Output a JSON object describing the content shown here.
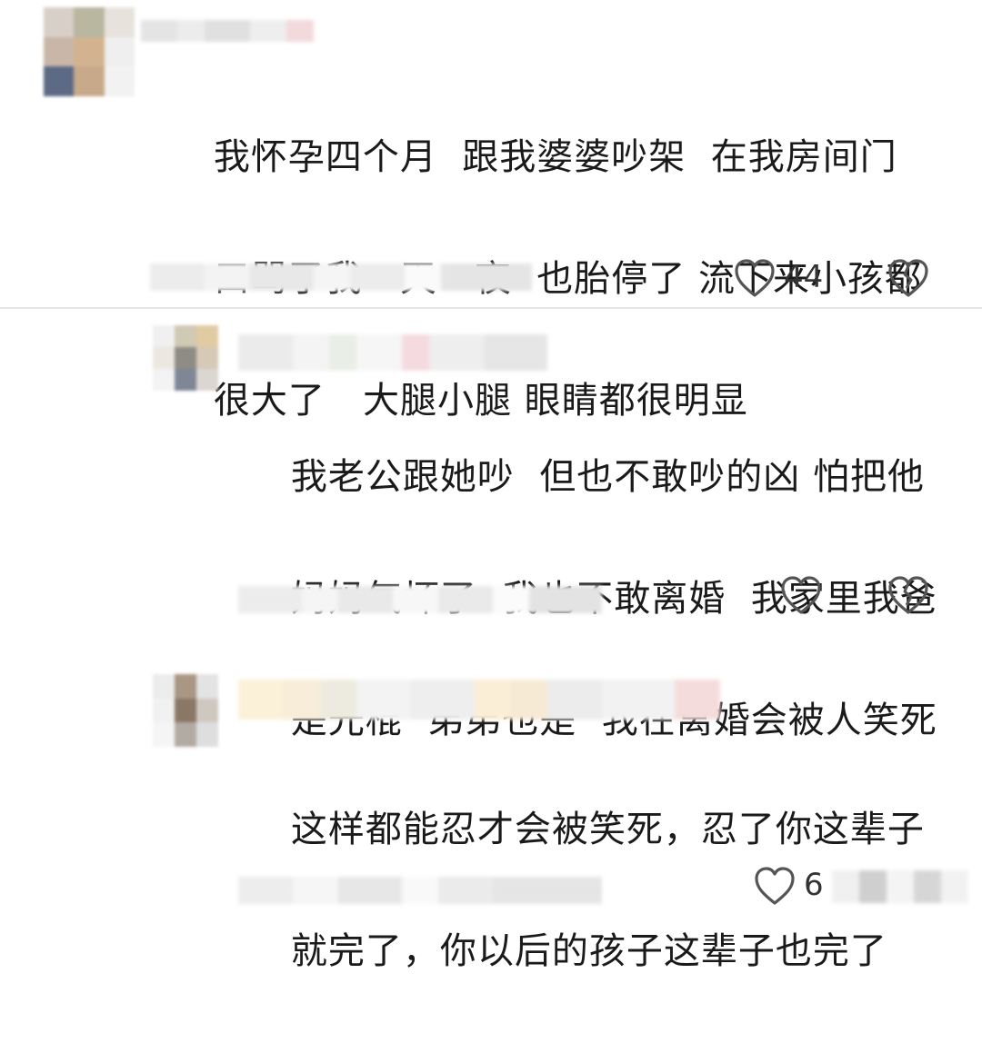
{
  "comments": [
    {
      "author": "",
      "lines": [
        "我怀孕四个月  跟我婆婆吵架  在我房间门",
        "口骂了我一天一夜  也胎停了 流下来小孩都",
        "很大了   大腿小腿 眼睛都很明显"
      ],
      "likes": "44",
      "icons": [
        "heart-outline-icon",
        "broken-heart-icon"
      ]
    },
    {
      "author": "",
      "lines": [
        "我老公跟她吵  但也不敢吵的凶 怕把他",
        "妈妈气坏了  我也不敢离婚  我家里我爸",
        "是光棍  弟弟也是  我在离婚会被人笑死"
      ],
      "likes": "",
      "icons": [
        "heart-outline-icon",
        "broken-heart-icon"
      ]
    },
    {
      "author": "",
      "lines": [
        "这样都能忍才会被笑死，忍了你这辈子",
        "就完了，你以后的孩子这辈子也完了"
      ],
      "likes": "6",
      "icons": [
        "heart-outline-icon"
      ]
    }
  ],
  "colors": {
    "text": "#1a1a1a",
    "icon": "#555555",
    "background": "#ffffff"
  }
}
